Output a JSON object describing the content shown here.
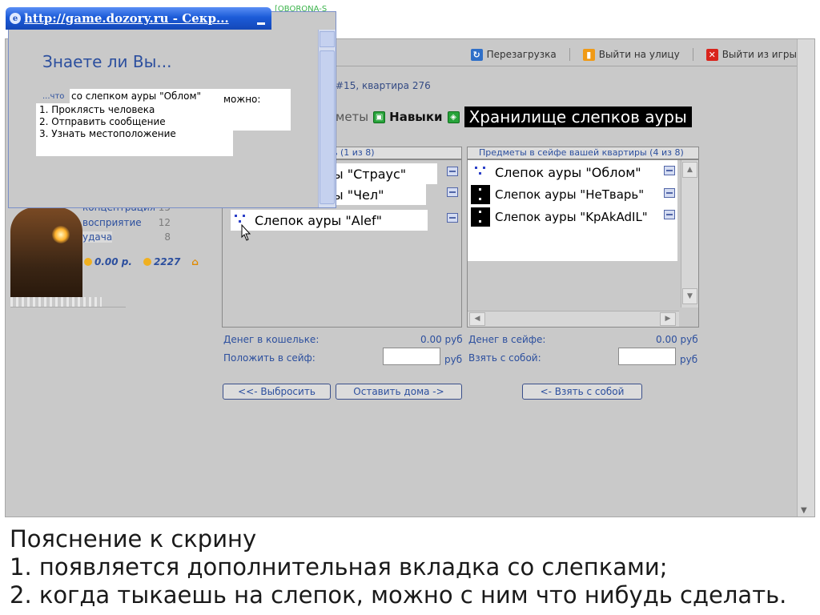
{
  "topright_text": "[OBORONA-S",
  "popup": {
    "title": "http://game.dozory.ru - Секр...",
    "heading": "Знаете ли Вы...",
    "question_prefix": "...что",
    "question_main": "со слепком ауры \"Облом\"",
    "question_end": "можно:",
    "options": [
      "1. Проклясть человека",
      "2. Отправить сообщение",
      "3. Узнать местоположение"
    ]
  },
  "topbar": {
    "reload_label": "Перезагрузка",
    "street_label": "Выйти на улицу",
    "exit_label": "Выйти из игры",
    "icons": [
      "reload-icon",
      "door-icon",
      "close-icon"
    ]
  },
  "location": "#15, квартира 276",
  "tabs": {
    "items_label": "меты",
    "skills_label": "Навыки",
    "storage_label": "Хранилище слепков ауры"
  },
  "stats": [
    {
      "name": "концентрация",
      "value": "15"
    },
    {
      "name": "восприятие",
      "value": "12"
    },
    {
      "name": "удача",
      "value": "8"
    }
  ],
  "money": {
    "rubles": "0.00 р.",
    "points": "2227"
  },
  "left_panel": {
    "header": "рь (1 из 8)",
    "items": [
      "ы \"Страус\"",
      "ы \"Чел\"",
      "Слепок ауры \"Alef\""
    ]
  },
  "right_panel": {
    "header": "Предметы в сейфе вашей квартиры (4 из 8)",
    "items": [
      "Слепок ауры \"Облом\"",
      "Слепок ауры \"НеТварь\"",
      "Слепок ауры \"KpAkAdIL\""
    ]
  },
  "wallet": {
    "label": "Денег в кошельке:",
    "value": "0.00 руб",
    "put_label": "Положить в сейф:",
    "put_unit": "руб"
  },
  "safe": {
    "label": "Денег в сейфе:",
    "value": "0.00 руб",
    "take_label": "Взять с собой:",
    "take_unit": "руб"
  },
  "buttons": {
    "throw": "<<- Выбросить",
    "leave_home": "Оставить дома ->",
    "take": "<- Взять с собой"
  },
  "explanation": {
    "title": "Пояснение к скрину",
    "line1": "1. появляется дополнительная вкладка со слепками;",
    "line2": "2. когда тыкаешь на слепок, можно с ним что нибудь сделать."
  },
  "colors": {
    "accent": "#2c4f9e",
    "titlebar": "#1c5bd8",
    "background": "#c9c9c9",
    "storage_tab": "#000000"
  }
}
